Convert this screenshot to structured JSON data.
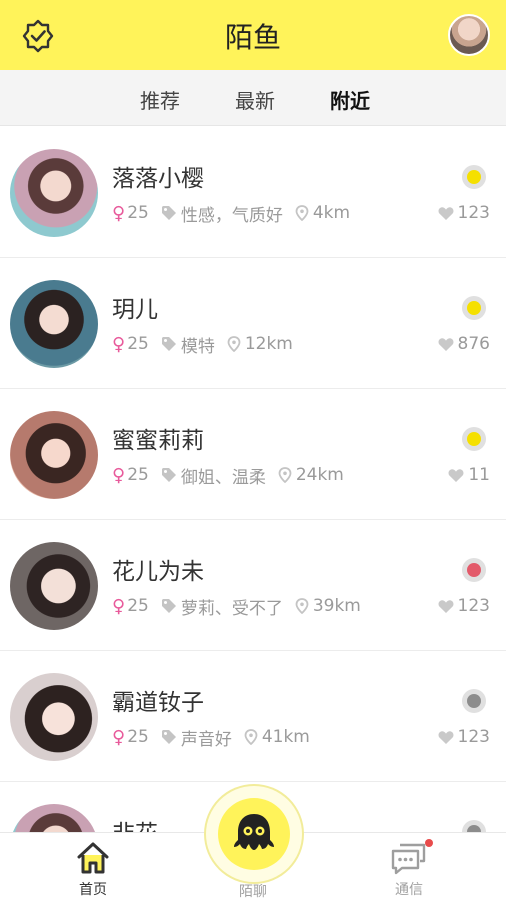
{
  "header": {
    "title": "陌鱼",
    "verify_icon": "verified-badge-icon",
    "avatar": "user-avatar"
  },
  "tabs": [
    {
      "label": "推荐",
      "active": false
    },
    {
      "label": "最新",
      "active": false
    },
    {
      "label": "附近",
      "active": true
    }
  ],
  "users": [
    {
      "name": "落落小樱",
      "age": "25",
      "tags": "性感，气质好",
      "distance": "4km",
      "likes": "123",
      "status_color": "#f5e000"
    },
    {
      "name": "玥儿",
      "age": "25",
      "tags": "模特",
      "distance": "12km",
      "likes": "876",
      "status_color": "#f5e000"
    },
    {
      "name": "蜜蜜莉莉",
      "age": "25",
      "tags": "御姐、温柔",
      "distance": "24km",
      "likes": "11",
      "status_color": "#f5e000"
    },
    {
      "name": "花儿为未",
      "age": "25",
      "tags": "萝莉、受不了",
      "distance": "39km",
      "likes": "123",
      "status_color": "#e35a6a"
    },
    {
      "name": "霸道钕子",
      "age": "25",
      "tags": "声音好",
      "distance": "41km",
      "likes": "123",
      "status_color": "#8c8c8c"
    },
    {
      "name": "非花",
      "age": "",
      "tags": "",
      "distance": "",
      "likes": "",
      "status_color": "#8c8c8c"
    }
  ],
  "gender_symbol": "♀",
  "bottom_nav": {
    "home_label": "首页",
    "chat_label": "陌聊",
    "messages_label": "通信"
  },
  "colors": {
    "brand_yellow": "#fff35a",
    "gender_pink": "#e85a9b",
    "notify_red": "#e84b4b"
  }
}
